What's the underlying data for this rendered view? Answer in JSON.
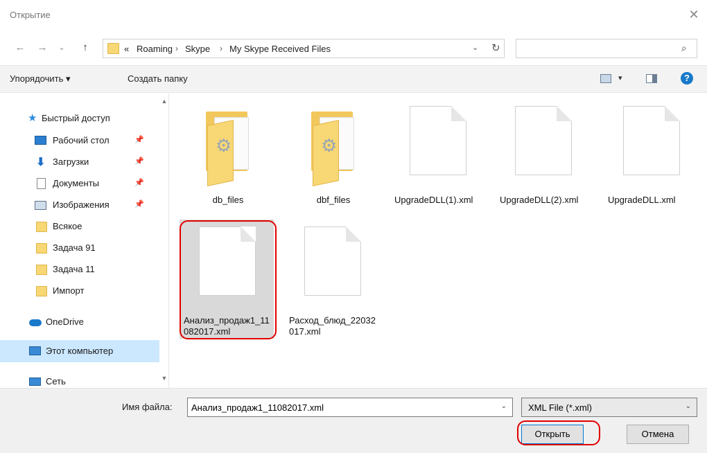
{
  "window": {
    "title": "Открытие",
    "close_glyph": "✕"
  },
  "nav": {
    "back_glyph": "←",
    "forward_glyph": "→",
    "recent_glyph": "⌄",
    "up_glyph": "↑"
  },
  "address": {
    "prefix": "«",
    "crumbs": [
      "Roaming",
      "Skype",
      "My Skype Received Files"
    ],
    "separator": "›",
    "dropdown_glyph": "⌄",
    "refresh_glyph": "↻"
  },
  "search": {
    "placeholder": "",
    "icon_glyph": "⌕"
  },
  "toolbar": {
    "organize_label": "Упорядочить ▾",
    "new_folder_label": "Создать папку",
    "view_dropdown_glyph": "▾",
    "help_glyph": "?"
  },
  "sidebar": {
    "items": [
      {
        "label": "Быстрый доступ",
        "icon": "star-icon"
      },
      {
        "label": "Рабочий стол",
        "icon": "desktop-icon",
        "pinned": true
      },
      {
        "label": "Загрузки",
        "icon": "download-icon",
        "pinned": true
      },
      {
        "label": "Документы",
        "icon": "documents-icon",
        "pinned": true
      },
      {
        "label": "Изображения",
        "icon": "pictures-icon",
        "pinned": true
      },
      {
        "label": "Всякое",
        "icon": "folder-icon"
      },
      {
        "label": "Задача 91",
        "icon": "folder-icon"
      },
      {
        "label": "Задача 11",
        "icon": "folder-icon"
      },
      {
        "label": "Импорт",
        "icon": "folder-icon"
      },
      {
        "label": "OneDrive",
        "icon": "onedrive-icon"
      },
      {
        "label": "Этот компьютер",
        "icon": "computer-icon",
        "selected": true
      },
      {
        "label": "Сеть",
        "icon": "network-icon"
      }
    ],
    "pin_glyph": "📌",
    "scroll_up_glyph": "▲",
    "scroll_down_glyph": "▼"
  },
  "files": [
    {
      "name": "db_files",
      "type": "folder"
    },
    {
      "name": "dbf_files",
      "type": "folder"
    },
    {
      "name": "UpgradeDLL(1).xml",
      "type": "file"
    },
    {
      "name": "UpgradeDLL(2).xml",
      "type": "file"
    },
    {
      "name": "UpgradeDLL.xml",
      "type": "file"
    },
    {
      "name": "Анализ_продаж1_11082017.xml",
      "type": "file",
      "selected": true
    },
    {
      "name": "Расход_блюд_22032017.xml",
      "type": "file"
    }
  ],
  "footer": {
    "filename_label": "Имя файла:",
    "filename_value": "Анализ_продаж1_11082017.xml",
    "filetype_value": "XML File (*.xml)",
    "dropdown_glyph": "⌄",
    "open_label": "Открыть",
    "cancel_label": "Отмена"
  },
  "colors": {
    "highlight_ring": "#e00000",
    "selection": "#d9d9d9",
    "nav_selection": "#cce8ff",
    "accent": "#1979ca"
  }
}
